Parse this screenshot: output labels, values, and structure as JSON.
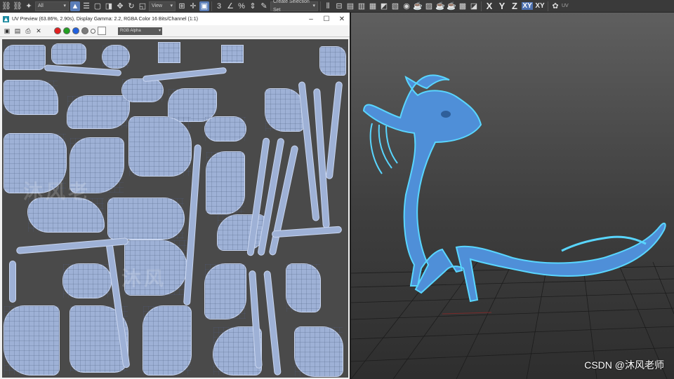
{
  "toolbar": {
    "filter_value": "All",
    "refcoord_value": "View",
    "selection_set_placeholder": "Create Selection Set",
    "axes": [
      "X",
      "Y",
      "Z",
      "XY",
      "XY"
    ],
    "uv_label": "UV",
    "icons": [
      "link-icon",
      "unlink-icon",
      "bind-icon",
      "select-icon",
      "select-by-name-icon",
      "rect-region-icon",
      "window-crossing-icon",
      "move-icon",
      "rotate-icon",
      "scale-icon",
      "select-manipulate-icon",
      "snap-icon",
      "angle-snap-icon",
      "percent-snap-icon",
      "spinner-snap-icon",
      "edit-selection-set-icon",
      "mirror-icon",
      "align-icon",
      "toggle-scene-explorer-icon",
      "toggle-layer-explorer-icon",
      "curve-editor-icon",
      "schematic-view-icon",
      "material-editor-icon",
      "render-setup-icon",
      "rendered-frame-icon",
      "render-icon"
    ]
  },
  "uv_window": {
    "title": "UV Preview (63.86%, 2.90s), Display Gamma: 2.2, RGBA Color 16 Bits/Channel (1:1)",
    "channel_select": "RGB Alpha",
    "channel_dots": [
      "#e02020",
      "#22a022",
      "#2060e0",
      "#7a7a7a",
      "#ffffff"
    ],
    "island_color": "#9eb1d6",
    "background_color": "#4a4a4a"
  },
  "viewport": {
    "background_top": "#5f5f5f",
    "model_color": "#4f8fd8",
    "selection_outline": "#59d6ff"
  },
  "watermark": "CSDN @沐风老师"
}
